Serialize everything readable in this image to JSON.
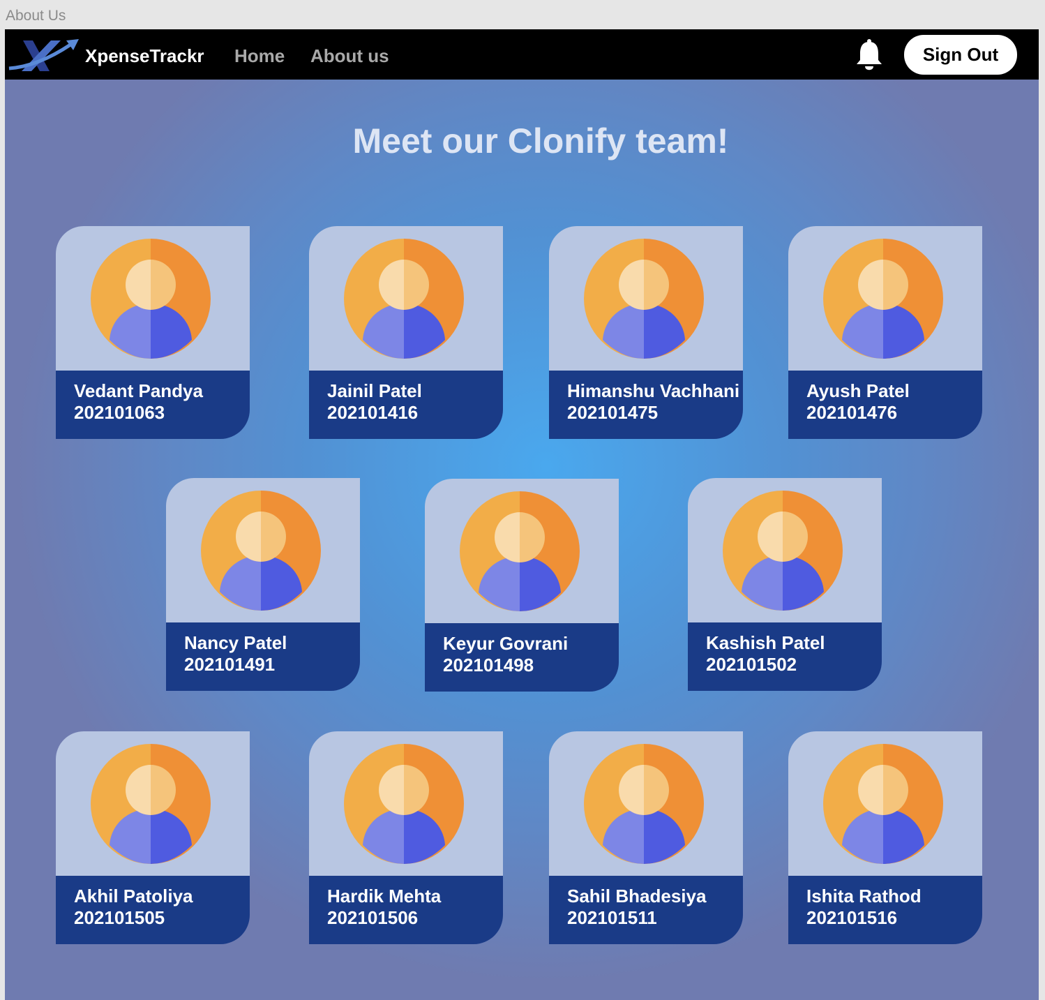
{
  "window": {
    "frame_label": "About Us"
  },
  "navbar": {
    "brand": "XpenseTrackr",
    "links": [
      {
        "label": "Home"
      },
      {
        "label": "About us"
      }
    ],
    "notification_icon": "bell-icon",
    "signout_label": "Sign Out"
  },
  "main": {
    "title": "Meet our Clonify team!",
    "members": [
      {
        "name": "Vedant Pandya",
        "id": "202101063"
      },
      {
        "name": "Jainil Patel",
        "id": "202101416"
      },
      {
        "name": "Himanshu Vachhani",
        "id": "202101475"
      },
      {
        "name": "Ayush Patel",
        "id": "202101476"
      },
      {
        "name": "Nancy Patel",
        "id": "202101491"
      },
      {
        "name": "Keyur Govrani",
        "id": "202101498"
      },
      {
        "name": "Kashish Patel",
        "id": "202101502"
      },
      {
        "name": "Akhil Patoliya",
        "id": "202101505"
      },
      {
        "name": "Hardik Mehta",
        "id": "202101506"
      },
      {
        "name": "Sahil Bhadesiya",
        "id": "202101511"
      },
      {
        "name": "Ishita Rathod",
        "id": "202101516"
      }
    ]
  },
  "colors": {
    "navbar_bg": "#000000",
    "card_top": "#b8c6e2",
    "card_bottom": "#1a3b87",
    "title_text": "#dde5f4",
    "avatar_orange_light": "#f2ad48",
    "avatar_orange_dark": "#ef9036",
    "avatar_body_light": "#7d86e6",
    "avatar_body_dark": "#4f5be0"
  }
}
